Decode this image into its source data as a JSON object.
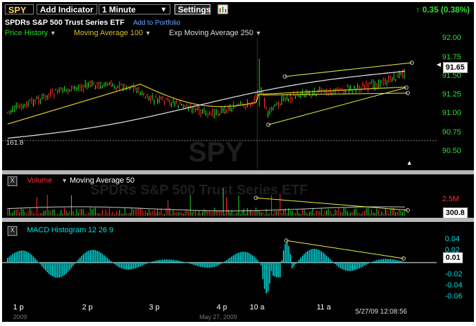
{
  "toolbar": {
    "symbol": "SPY",
    "add_indicator": "Add Indicator",
    "interval": "1 Minute",
    "settings": "Settings",
    "change": "0.35 (0.38%)"
  },
  "header": {
    "security_name": "SPDRs S&P 500 Trust Series ETF",
    "add_to_portfolio": "Add to Portfolio",
    "indicators": [
      "Price History",
      "Moving Average 100",
      "Exp Moving Average 250"
    ]
  },
  "price_panel": {
    "watermark": "SPY",
    "last_price": "91.65",
    "reference_level": "161.8",
    "y_labels": [
      "92.00",
      "91.75",
      "91.50",
      "91.25",
      "91.00",
      "90.75",
      "90.50"
    ]
  },
  "volume_panel": {
    "title": "Volume",
    "ma_label": "Moving Average 50",
    "watermark": "SPDRs S&P 500 Trust Series ETF",
    "axis_label": "2.5M",
    "last_value": "300.8"
  },
  "macd_panel": {
    "title": "MACD Histogram 12 26 9",
    "y_labels": [
      "0.04",
      "0.02",
      "-0.02",
      "-0.04",
      "-0.06"
    ],
    "last_value": "0.01"
  },
  "time_axis": {
    "labels": [
      "1 p",
      "2 p",
      "3 p",
      "4 p",
      "10 a",
      "11 a"
    ],
    "timestamp": "5/27/09 12:08:56",
    "date_fragment": "May 27, 2009",
    "year_fragment": "2009"
  },
  "colors": {
    "price_history": "#22dd22",
    "ma100": "#d8c020",
    "ema250": "#dddddd",
    "volume_title": "#ff3030",
    "macd": "#00e0e0",
    "trendline": "#f0f040",
    "axis_green": "#2fe02f",
    "axis_red": "#ff3030"
  },
  "icons": [
    "x-close-icon",
    "chevron-down-icon",
    "up-arrow-icon",
    "export-icon",
    "triangle-up-icon",
    "triangle-left-icon"
  ]
}
